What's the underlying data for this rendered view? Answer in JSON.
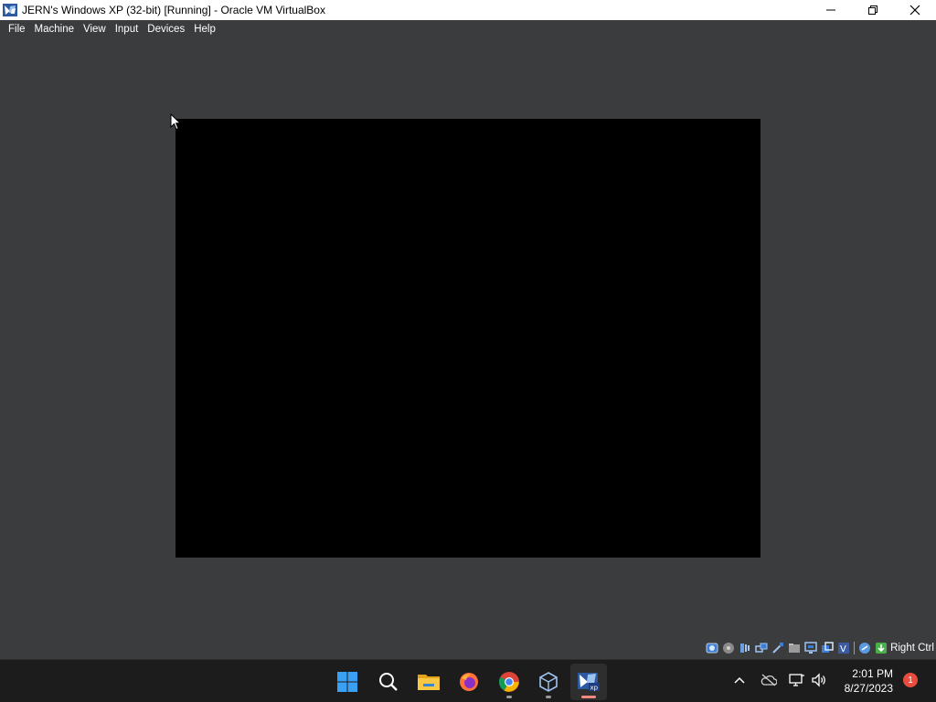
{
  "window": {
    "title": "JERN's Windows XP (32-bit) [Running] - Oracle VM VirtualBox",
    "controls": [
      "minimize-icon",
      "maximize-icon",
      "close-icon"
    ]
  },
  "menu": {
    "items": [
      "File",
      "Machine",
      "View",
      "Input",
      "Devices",
      "Help"
    ]
  },
  "vm": {
    "screen_color": "#000000",
    "background_color": "#3b3c3e"
  },
  "statusbar": {
    "icons": [
      "hard-disk-icon",
      "optical-drive-icon",
      "audio-icon",
      "network-icon",
      "usb-icon",
      "shared-folders-icon",
      "display-icon",
      "video-capture-icon",
      "virtualization-icon",
      "cpu-icon",
      "mouse-integration-icon"
    ],
    "host_key": "Right Ctrl"
  },
  "taskbar": {
    "apps": [
      "windows-start-icon",
      "search-icon",
      "file-explorer-icon",
      "firefox-icon",
      "chrome-icon",
      "virtualbox-icon",
      "virtualbox-vm-xp-icon"
    ],
    "tray": [
      "show-hidden-icons-chevron",
      "onedrive-icon",
      "network-icon",
      "volume-icon"
    ],
    "clock": {
      "time": "2:01 PM",
      "date": "8/27/2023"
    },
    "notifications": "1"
  },
  "colors": {
    "accent_indicator": "#f08a80",
    "taskbar_bg": "#1c1c1c",
    "titlebar_bg": "#ffffff"
  }
}
